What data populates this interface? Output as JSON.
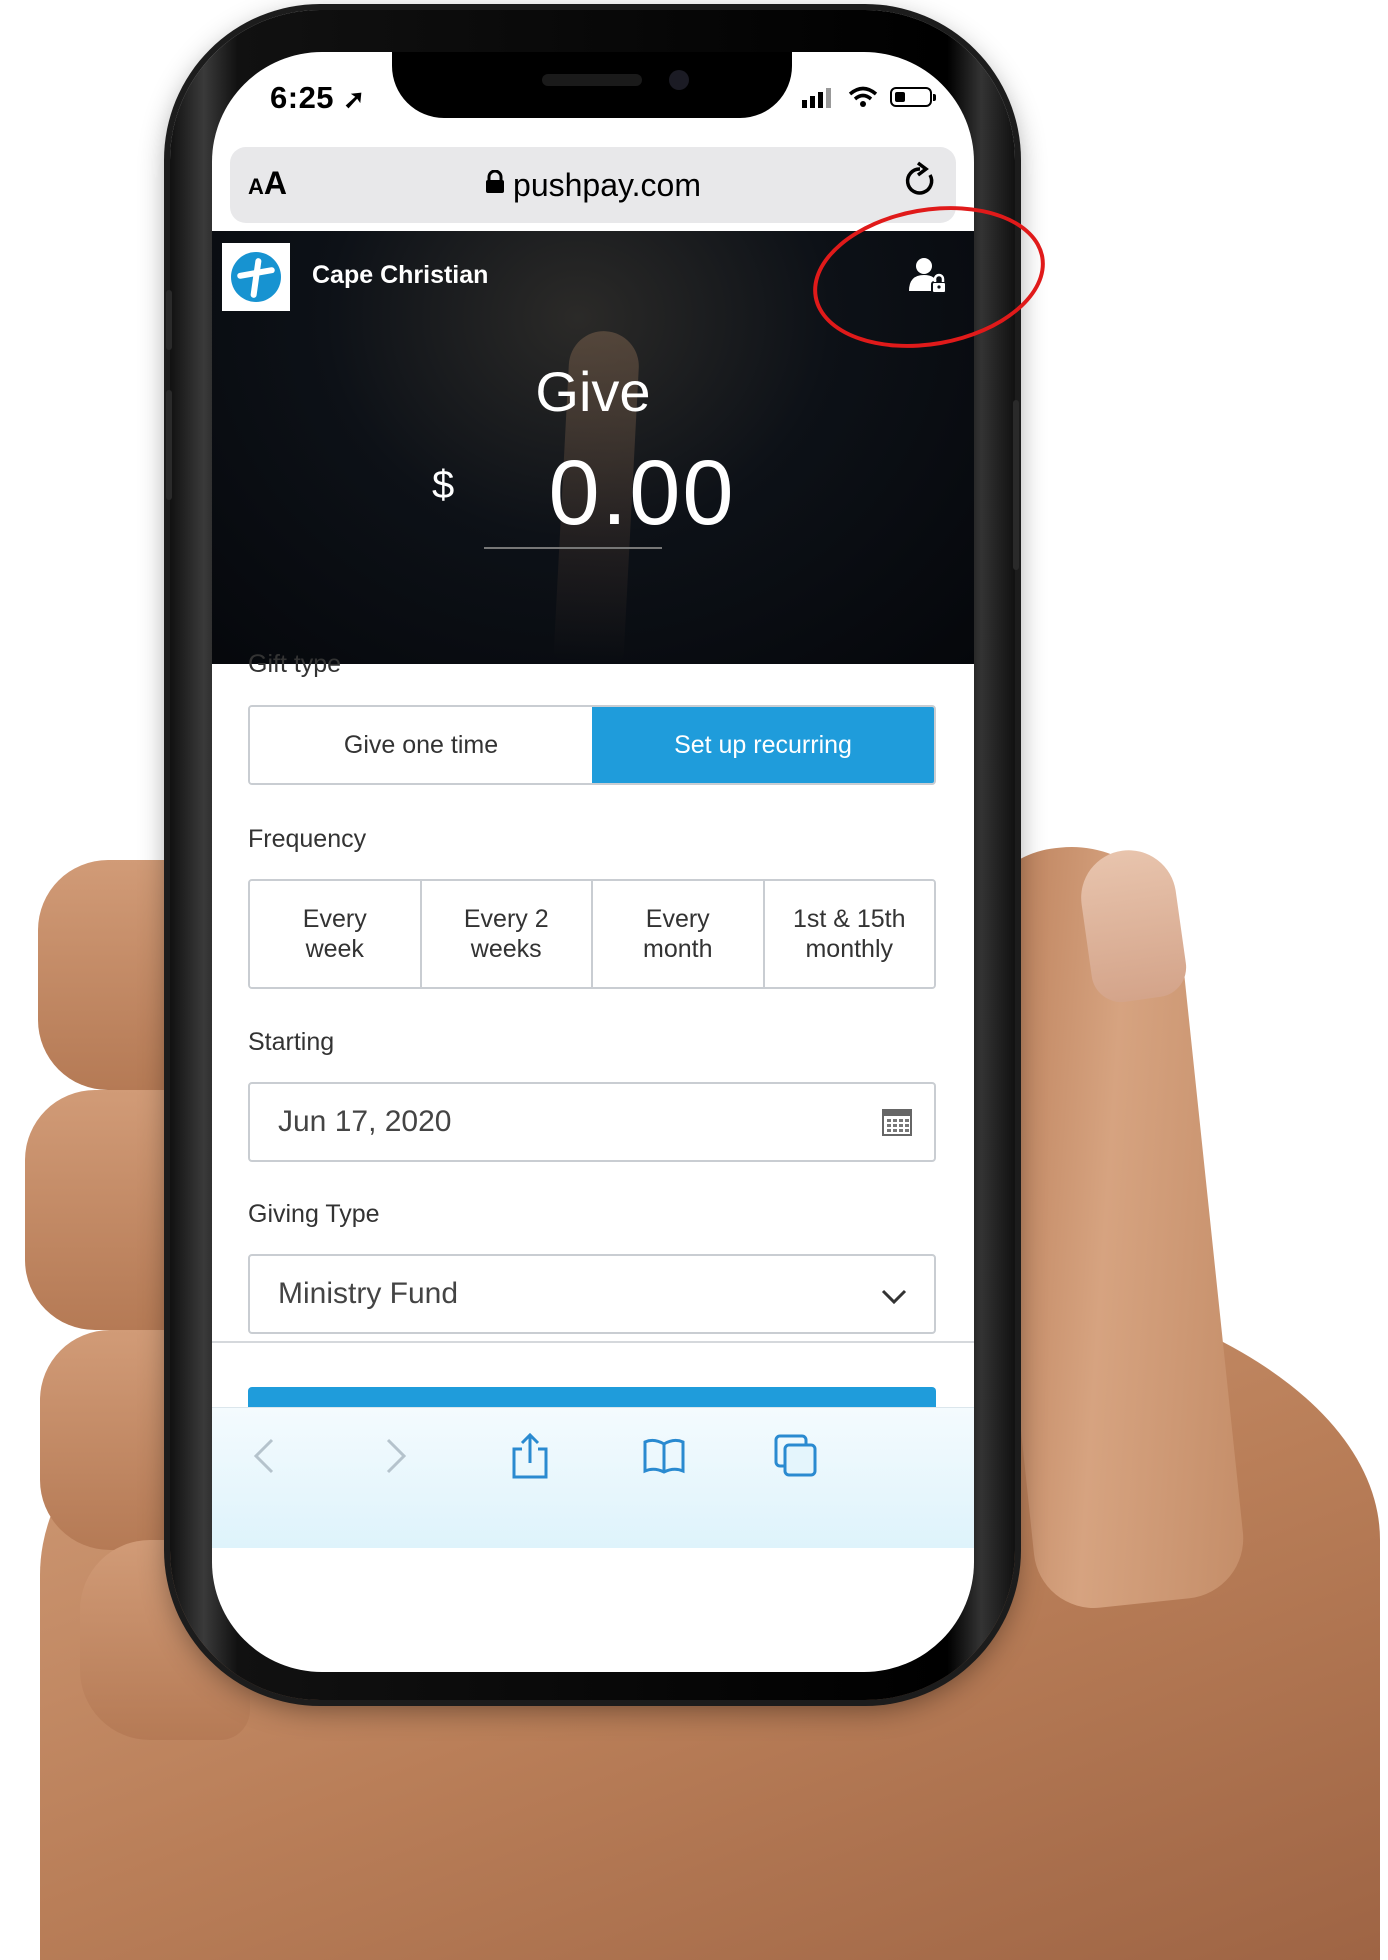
{
  "status_bar": {
    "time": "6:25"
  },
  "browser": {
    "text_size_small": "A",
    "text_size_large": "A",
    "url": "pushpay.com"
  },
  "header": {
    "org_name": "Cape Christian",
    "title": "Give",
    "currency_symbol": "$",
    "amount": "0.00"
  },
  "form": {
    "gift_type_label": "Gift type",
    "gift_type_options": [
      "Give one time",
      "Set up recurring"
    ],
    "gift_type_selected": "Set up recurring",
    "frequency_label": "Frequency",
    "frequency_options": [
      [
        "Every",
        "week"
      ],
      [
        "Every 2",
        "weeks"
      ],
      [
        "Every",
        "month"
      ],
      [
        "1st & 15th",
        "monthly"
      ]
    ],
    "starting_label": "Starting",
    "starting_value": "Jun 17, 2020",
    "giving_type_label": "Giving Type",
    "giving_type_value": "Ministry Fund"
  },
  "colors": {
    "accent": "#1f9cdb",
    "annotation": "#e01a1a",
    "header_bg": "#0d1117"
  }
}
